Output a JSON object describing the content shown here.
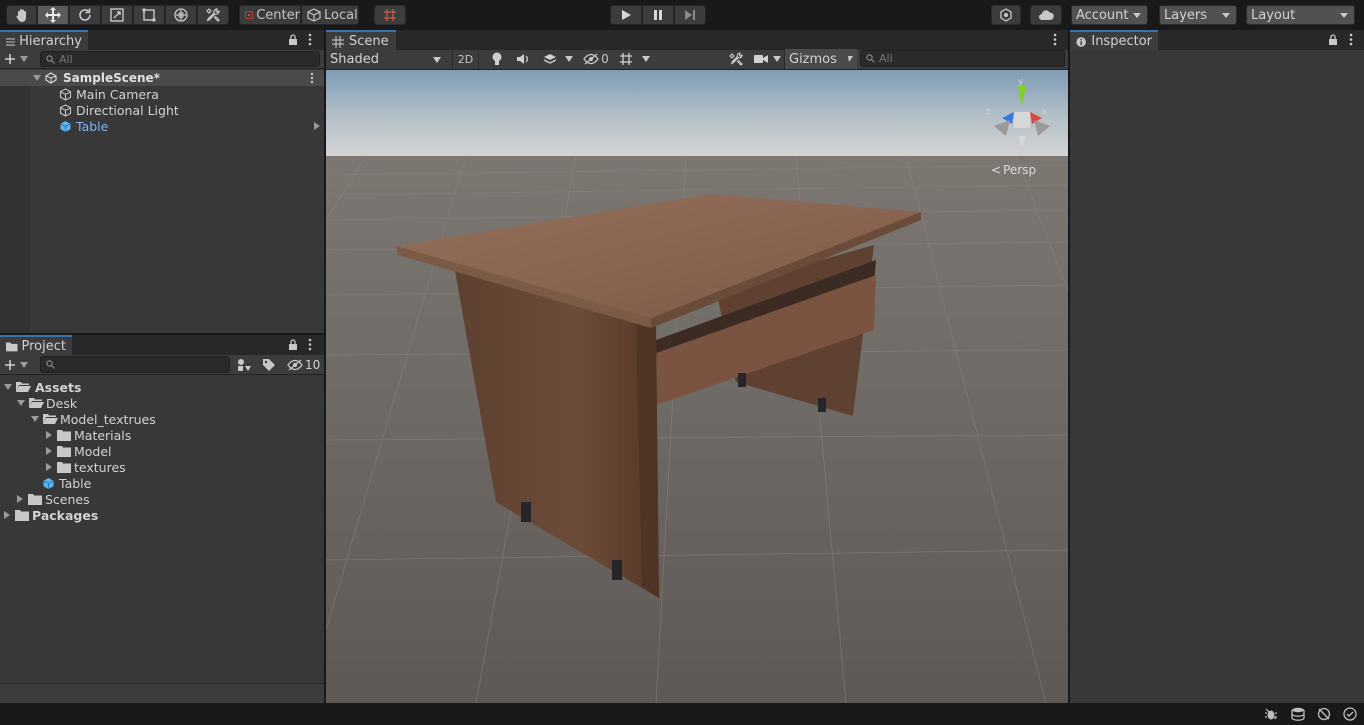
{
  "toolbar": {
    "tools": [
      "hand-tool-icon",
      "move-tool-icon",
      "rotate-tool-icon",
      "scale-tool-icon",
      "rect-tool-icon",
      "transform-tool-icon",
      "custom-tool-icon"
    ],
    "pivot_label": "Center",
    "space_label": "Local",
    "play_controls": [
      "play-icon",
      "pause-icon",
      "step-icon"
    ],
    "account_label": "Account",
    "layers_label": "Layers",
    "layout_label": "Layout"
  },
  "hierarchy": {
    "tab_label": "Hierarchy",
    "search_placeholder": "All",
    "scene_name": "SampleScene*",
    "items": [
      {
        "label": "Main Camera"
      },
      {
        "label": "Directional Light"
      },
      {
        "label": "Table"
      }
    ]
  },
  "project": {
    "tab_label": "Project",
    "hidden_count": "10",
    "tree": [
      {
        "label": "Assets"
      },
      {
        "label": "Desk"
      },
      {
        "label": "Model_textrues"
      },
      {
        "label": "Materials"
      },
      {
        "label": "Model"
      },
      {
        "label": "textures"
      },
      {
        "label": "Table"
      },
      {
        "label": "Scenes"
      },
      {
        "label": "Packages"
      }
    ]
  },
  "scene": {
    "tab_label": "Scene",
    "shading_mode": "Shaded",
    "mode_2d": "2D",
    "hidden_count": "0",
    "gizmos_label": "Gizmos",
    "search_placeholder": "All",
    "persp_label": "Persp",
    "axis_labels": {
      "y": "y",
      "z": "z",
      "x": "x"
    }
  },
  "inspector": {
    "tab_label": "Inspector"
  },
  "colors": {
    "selection_blue": "#7fb3f5",
    "tab_accent": "#3a72b0",
    "axis_y": "#7ed321",
    "axis_x": "#e0433a",
    "axis_z": "#3a78e0"
  }
}
